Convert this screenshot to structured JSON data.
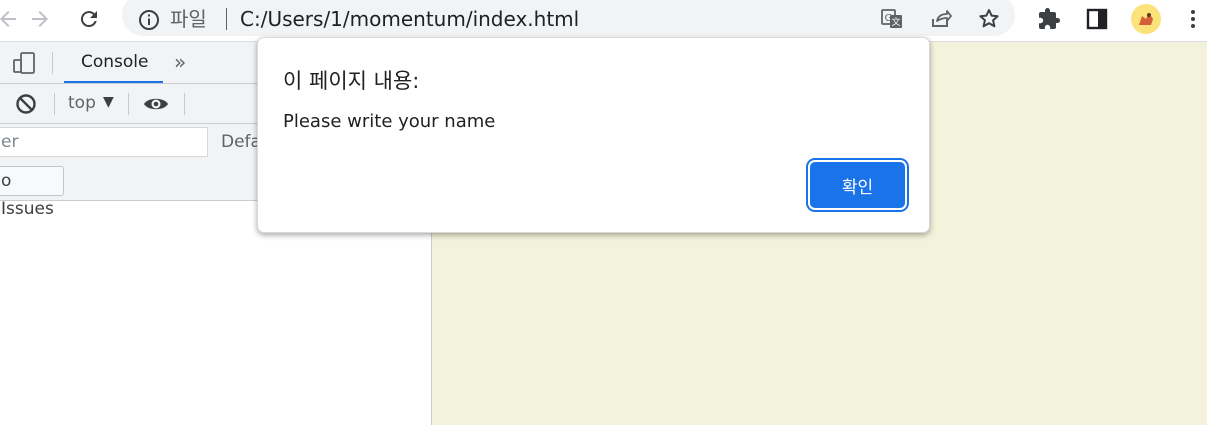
{
  "browser": {
    "url_scheme_label": "파일",
    "url": "C:/Users/1/momentum/index.html"
  },
  "devtools": {
    "active_tab": "Console",
    "more_tabs": "»",
    "context": "top",
    "filter_placeholder": "er",
    "levels_label": "Defa",
    "issues_label": "o Issues"
  },
  "dialog": {
    "title": "이 페이지 내용:",
    "message": "Please write your name",
    "ok_label": "확인"
  },
  "colors": {
    "accent": "#1a73e8",
    "page_background": "#f3f3dc"
  }
}
